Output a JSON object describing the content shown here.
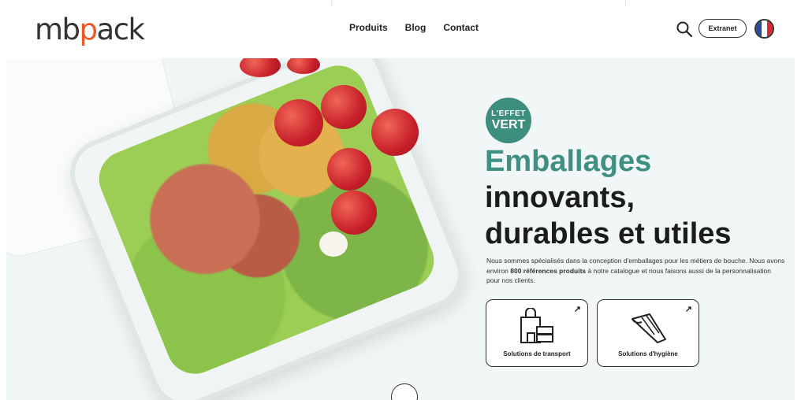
{
  "header": {
    "logo_prefix": "mb",
    "logo_accent": "p",
    "logo_suffix": "ack",
    "nav": [
      "Produits",
      "Blog",
      "Contact"
    ],
    "extranet_label": "Extranet",
    "icons": [
      "search-icon",
      "flag-fr-icon"
    ],
    "colors": {
      "logo_accent": "#e8592b",
      "flag_blue": "#2a4aa0",
      "flag_red": "#d8283a"
    }
  },
  "hero": {
    "badge_line1": "L'EFFET",
    "badge_line2": "VERT",
    "title_line1": "Emballages",
    "title_line2": "innovants,",
    "title_line3": "durables et utiles",
    "desc_part1": "Nous sommes spécialisés dans la conception d'emballages pour les métiers de bouche. Nous avons environ ",
    "desc_bold": "800 références produits",
    "desc_part2": " à notre catalogue et nous faisons aussi de la personnalisation pour nos clients.",
    "cards": [
      {
        "label": "Solutions de transport",
        "icon": "shopping-bag-boxes-icon"
      },
      {
        "label": "Solutions d'hygiène",
        "icon": "piping-bag-icon"
      }
    ],
    "colors": {
      "accent_green": "#3f8f82",
      "background": "#f1f6f6"
    }
  }
}
